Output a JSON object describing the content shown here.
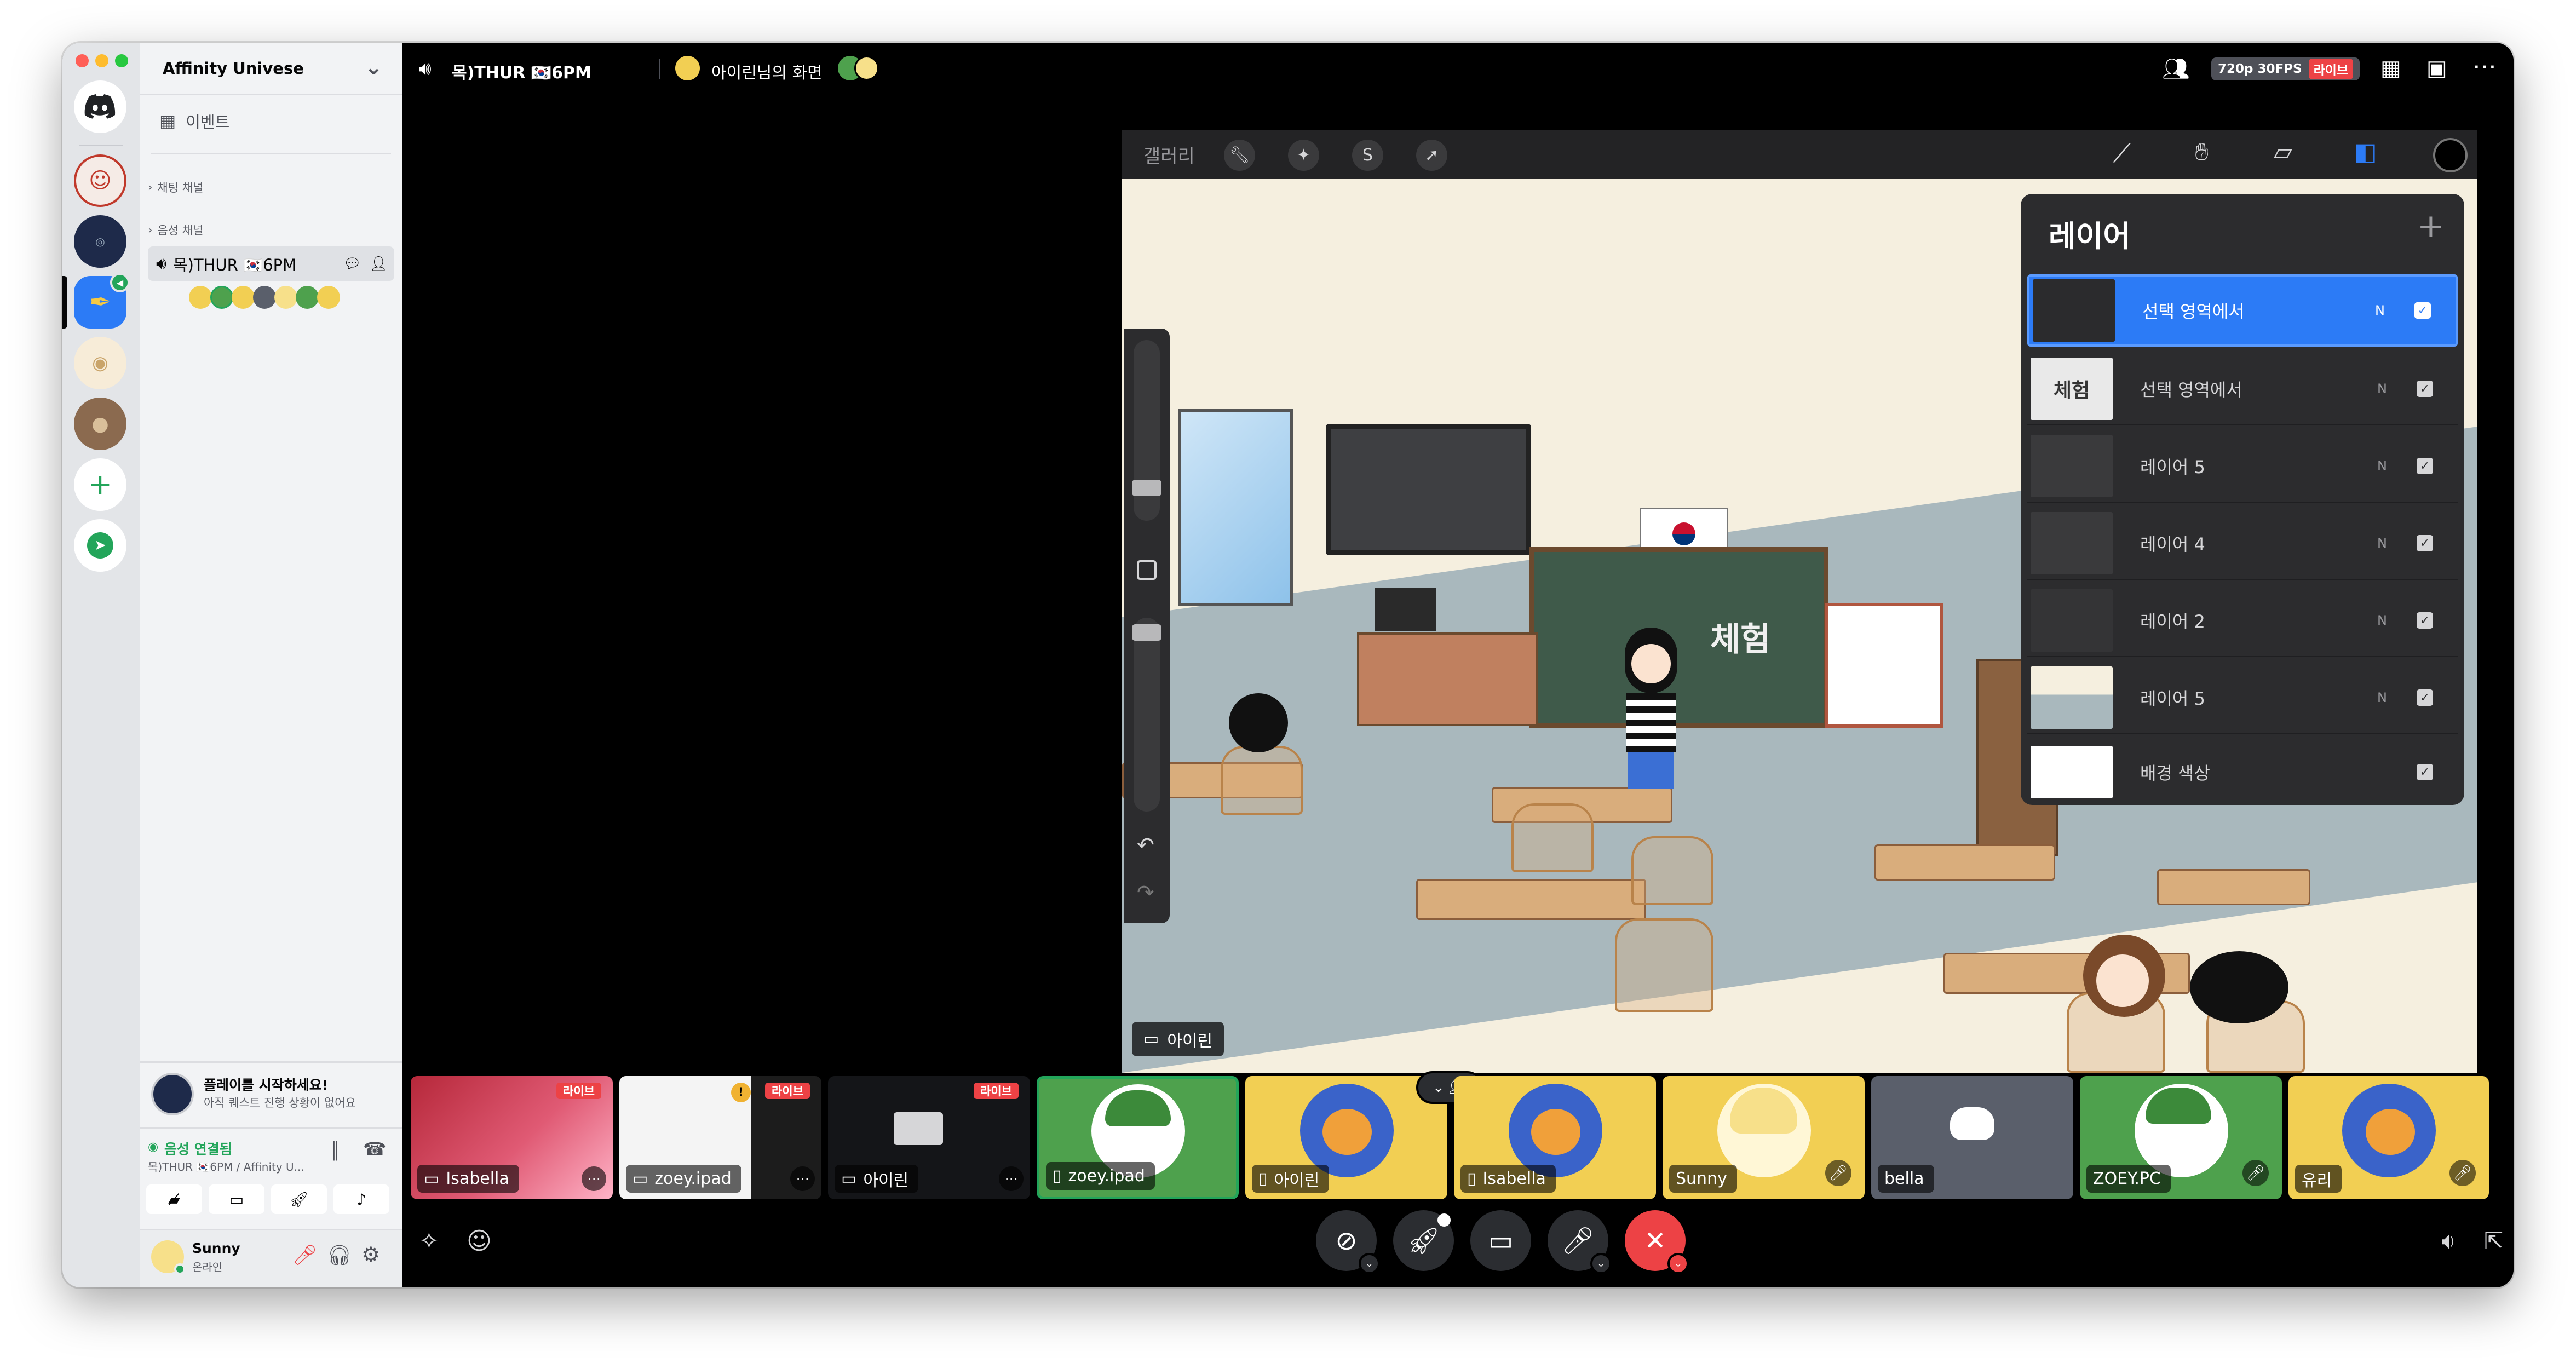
{
  "sidebar": {
    "server_name": "Affinity Univese",
    "events_label": "이벤트",
    "text_category": "채팅 채널",
    "voice_category": "음성 채널",
    "voice_channel_name": "목)THUR 🇰🇷6PM",
    "play_card": {
      "title": "플레이를 시작하세요!",
      "subtitle": "아직 퀘스트 진행 상황이 없어요"
    },
    "voice_status": {
      "title": "음성 연결됨",
      "subtitle": "목)THUR 🇰🇷6PM / Affinity U..."
    },
    "user": {
      "name": "Sunny",
      "status": "온라인"
    }
  },
  "topbar": {
    "channel": "목)THUR 🇰🇷6PM",
    "screen_share_title": "아이린님의 화면",
    "quality": "720p 30FPS",
    "live": "라이브"
  },
  "stream": {
    "gallery_label": "갤러리",
    "layers_title": "레이어",
    "layers": [
      {
        "name": "선택 영역에서",
        "mode": "N",
        "selected": true
      },
      {
        "name": "선택 영역에서",
        "mode": "N",
        "selected": false
      },
      {
        "name": "레이어 5",
        "mode": "N",
        "selected": false
      },
      {
        "name": "레이어 4",
        "mode": "N",
        "selected": false
      },
      {
        "name": "레이어 2",
        "mode": "N",
        "selected": false
      },
      {
        "name": "레이어 5",
        "mode": "N",
        "selected": false
      },
      {
        "name": "배경 색상",
        "mode": "",
        "selected": false
      }
    ],
    "blackboard_text": "체험",
    "streamer_label": "아이린"
  },
  "tiles": [
    {
      "label": "Isabella",
      "live": "라이브",
      "kind": "screen"
    },
    {
      "label": "zoey.ipad",
      "live": "라이브",
      "kind": "screen"
    },
    {
      "label": "아이린",
      "live": "라이브",
      "kind": "screen"
    },
    {
      "label": "zoey.ipad",
      "kind": "camera"
    },
    {
      "label": "아이린",
      "kind": "camera"
    },
    {
      "label": "Isabella",
      "kind": "camera"
    },
    {
      "label": "Sunny",
      "kind": "camera"
    },
    {
      "label": "bella",
      "kind": "camera"
    },
    {
      "label": "ZOEY.PC",
      "kind": "camera"
    },
    {
      "label": "유리",
      "kind": "camera"
    }
  ],
  "colors": {
    "accent_blue": "#2c7bf6",
    "live_red": "#ed4245",
    "tile_green": "#4ea14d",
    "tile_yellow": "#f2cf53",
    "tile_gray": "#5a5f6b"
  }
}
